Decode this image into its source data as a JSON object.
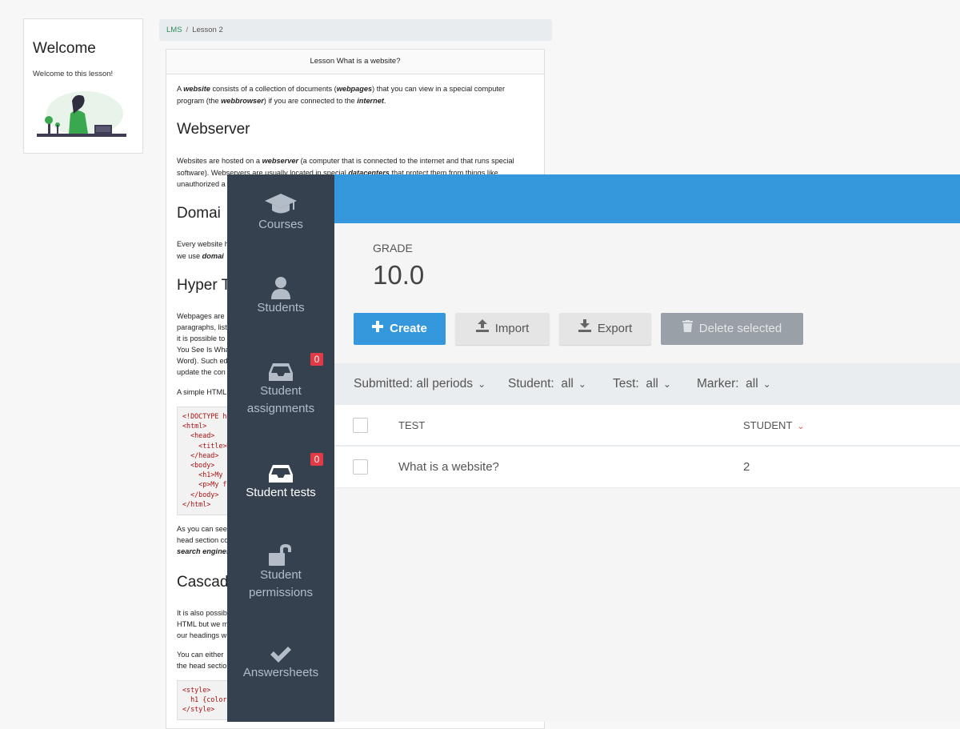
{
  "welcome": {
    "title": "Welcome",
    "text": "Welcome to this lesson!"
  },
  "breadcrumb": {
    "root": "LMS",
    "separator": "/",
    "current": "Lesson 2"
  },
  "lesson": {
    "header": "Lesson What is a website?",
    "intro": [
      "A ",
      "website",
      " consists of a collection of documents (",
      "webpages",
      ") that you can view in a special computer program (the ",
      "webbrowser",
      ") if you are connected to the ",
      "internet",
      "."
    ],
    "h_webserver": "Webserver",
    "webserver_text": [
      "Websites are hosted on a ",
      "webserver",
      " (a computer that is connected to the internet and that runs special software).  Webservers are usually located in special ",
      "datacenters",
      " that protect them from things like unauthorized a"
    ],
    "h_domain": "Domai",
    "domain_text_1": "Every website h",
    "domain_text_2a": "we use ",
    "domain_text_2b": "domai",
    "h_hyper": "Hyper T",
    "hyper_lines": [
      "Webpages are",
      "paragraphs, list",
      "it is possible to",
      "You See Is Wha",
      "Word). Such ed",
      "update the con"
    ],
    "simple_html": "A simple HTML",
    "code1": [
      "<!DOCTYPE ht",
      "<html>",
      "  <head>",
      "    <title>My",
      "  </head>",
      "  <body>",
      "    <h1>My Fir",
      "    <p>My first",
      "  </body>",
      "</html>"
    ],
    "after_code_1": "As you can see",
    "after_code_2": "head section co",
    "after_code_3": "search engines",
    "h_css": "Cascad",
    "css_lines": [
      "It is also possib",
      "HTML but we m",
      "our headings w"
    ],
    "either_lines": [
      "You can either",
      "the head sectio"
    ],
    "code2": [
      "<style>",
      "  h1 {color:",
      "</style>"
    ]
  },
  "sidebar": {
    "items": [
      {
        "label": "Courses",
        "icon": "graduation-cap-icon"
      },
      {
        "label": "Students",
        "icon": "user-icon"
      },
      {
        "label1": "Student",
        "label2": "assignments",
        "icon": "inbox-icon",
        "badge": "0"
      },
      {
        "label": "Student tests",
        "icon": "inbox-icon",
        "badge": "0",
        "active": true
      },
      {
        "label1": "Student",
        "label2": "permissions",
        "icon": "unlock-icon"
      },
      {
        "label": "Answersheets",
        "icon": "check-icon"
      }
    ]
  },
  "main": {
    "grade_label": "GRADE",
    "grade_value": "10.0",
    "buttons": {
      "create": "Create",
      "import": "Import",
      "export": "Export",
      "delete": "Delete selected"
    },
    "filters": [
      {
        "label": "Submitted: all periods"
      },
      {
        "label": "Student:  all"
      },
      {
        "label": "Test:  all"
      },
      {
        "label": "Marker:  all"
      }
    ],
    "table": {
      "headers": {
        "test": "TEST",
        "student": "STUDENT"
      },
      "rows": [
        {
          "test": "What is a website?",
          "student": "2"
        }
      ]
    }
  },
  "colors": {
    "accent": "#3598dc",
    "sidebar": "#364150",
    "badge": "#e43a45"
  }
}
